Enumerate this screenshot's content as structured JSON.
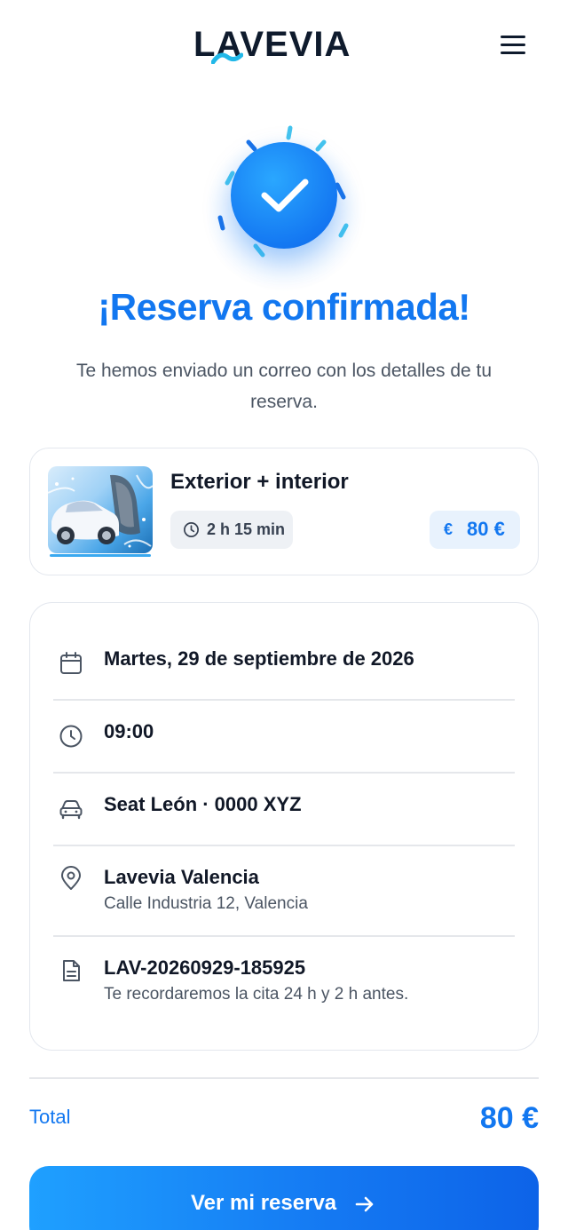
{
  "header": {
    "logo_text": "LAVEVIA",
    "menu_icon": "hamburger-menu-icon"
  },
  "hero": {
    "icon": "checkmark-icon",
    "title": "¡Reserva confirmada!",
    "subtitle": "Te hemos enviado un correo con los detalles de tu reserva."
  },
  "service": {
    "name": "Exterior + interior",
    "duration": "2 h 15 min",
    "price_currency": "€",
    "price": "80 €",
    "image_icon": "car-wash-image"
  },
  "details": {
    "date": "Martes, 29 de septiembre de 2026",
    "time": "09:00",
    "vehicle": "Seat León · 0000 XYZ",
    "location_name": "Lavevia Valencia",
    "location_address": "Calle Industria 12, Valencia",
    "reference": "LAV-20260929-185925",
    "reminder": "Te recordaremos la cita 24 h y 2 h antes."
  },
  "total": {
    "label": "Total",
    "value": "80 €"
  },
  "cta": {
    "label": "Ver mi reserva",
    "icon": "arrow-right-icon"
  },
  "colors": {
    "primary": "#1277f0",
    "dark": "#0f1b2d",
    "text_muted": "#4b5563",
    "border": "#e3e7ee"
  }
}
